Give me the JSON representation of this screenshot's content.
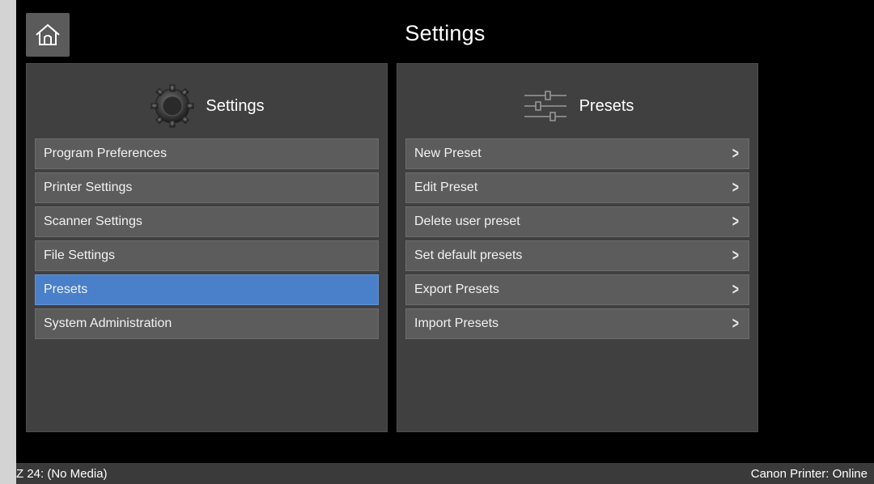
{
  "header": {
    "title": "Settings",
    "home_icon": "home-icon"
  },
  "left_panel": {
    "title": "Settings",
    "icon": "gear-icon",
    "items": [
      {
        "label": "Program Preferences"
      },
      {
        "label": "Printer Settings"
      },
      {
        "label": "Scanner Settings"
      },
      {
        "label": "File Settings"
      },
      {
        "label": "Presets",
        "selected": true
      },
      {
        "label": "System Administration"
      }
    ]
  },
  "right_panel": {
    "title": "Presets",
    "icon": "sliders-icon",
    "items": [
      {
        "label": "New Preset"
      },
      {
        "label": "Edit Preset"
      },
      {
        "label": "Delete user preset"
      },
      {
        "label": "Set default presets"
      },
      {
        "label": "Export Presets"
      },
      {
        "label": "Import Presets"
      }
    ]
  },
  "status": {
    "left": "Z 24: (No Media)",
    "right": "Canon Printer: Online"
  },
  "colors": {
    "background": "#000000",
    "panel": "#404040",
    "item": "#5c5c5c",
    "selected": "#4a7fc9"
  }
}
